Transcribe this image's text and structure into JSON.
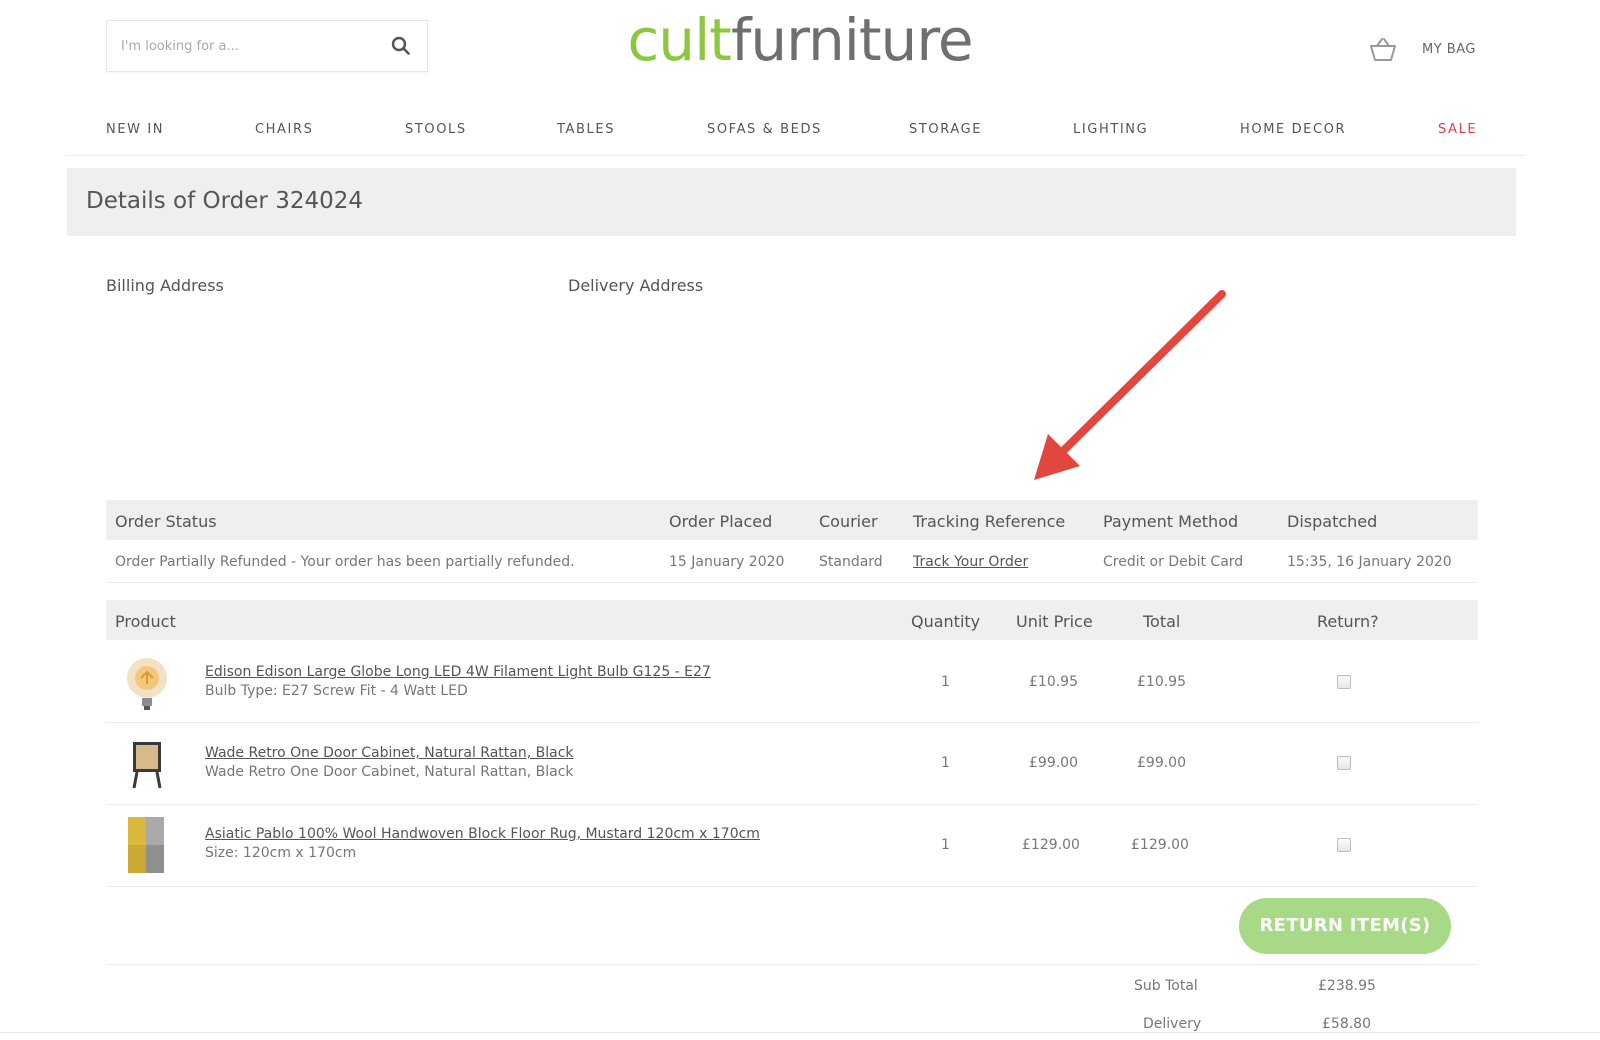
{
  "header": {
    "search_placeholder": "I'm looking for a...",
    "logo_part1": "cult",
    "logo_part2": "furniture",
    "bag_label": "MY BAG"
  },
  "nav": {
    "items": [
      "NEW IN",
      "CHAIRS",
      "STOOLS",
      "TABLES",
      "SOFAS & BEDS",
      "STORAGE",
      "LIGHTING",
      "HOME DECOR",
      "SALE"
    ]
  },
  "order": {
    "title": "Details of Order 324024",
    "billing_label": "Billing Address",
    "delivery_label": "Delivery Address"
  },
  "status_table": {
    "headers": [
      "Order Status",
      "Order Placed",
      "Courier",
      "Tracking Reference",
      "Payment Method",
      "Dispatched"
    ],
    "row": {
      "status": "Order Partially Refunded - Your order has been partially refunded.",
      "placed": "15 January 2020",
      "courier": "Standard",
      "tracking": "Track Your Order",
      "payment": "Credit or Debit Card",
      "dispatched": "15:35, 16 January 2020"
    }
  },
  "products_table": {
    "headers": [
      "Product",
      "Quantity",
      "Unit Price",
      "Total",
      "Return?"
    ],
    "rows": [
      {
        "name": "Edison Edison Large Globe Long LED 4W Filament Light Bulb G125 - E27",
        "sub": "Bulb Type: E27 Screw Fit - 4 Watt LED",
        "qty": "1",
        "unit": "£10.95",
        "total": "£10.95"
      },
      {
        "name": "Wade Retro One Door Cabinet, Natural Rattan, Black",
        "sub": "Wade Retro One Door Cabinet, Natural Rattan, Black",
        "qty": "1",
        "unit": "£99.00",
        "total": "£99.00"
      },
      {
        "name": "Asiatic Pablo 100% Wool Handwoven Block Floor Rug, Mustard 120cm x 170cm",
        "sub": "Size: 120cm x 170cm",
        "qty": "1",
        "unit": "£129.00",
        "total": "£129.00"
      }
    ]
  },
  "actions": {
    "return_button": "RETURN ITEM(S)"
  },
  "totals": {
    "subtotal_label": "Sub Total",
    "subtotal": "£238.95",
    "delivery_label": "Delivery",
    "delivery": "£58.80"
  },
  "colors": {
    "brand_green": "#8dc63f",
    "button_green": "#a8d986",
    "sale_red": "#e04040",
    "arrow_red": "#e2463f"
  },
  "icons": [
    "search-icon",
    "basket-icon",
    "arrow-annotation"
  ]
}
